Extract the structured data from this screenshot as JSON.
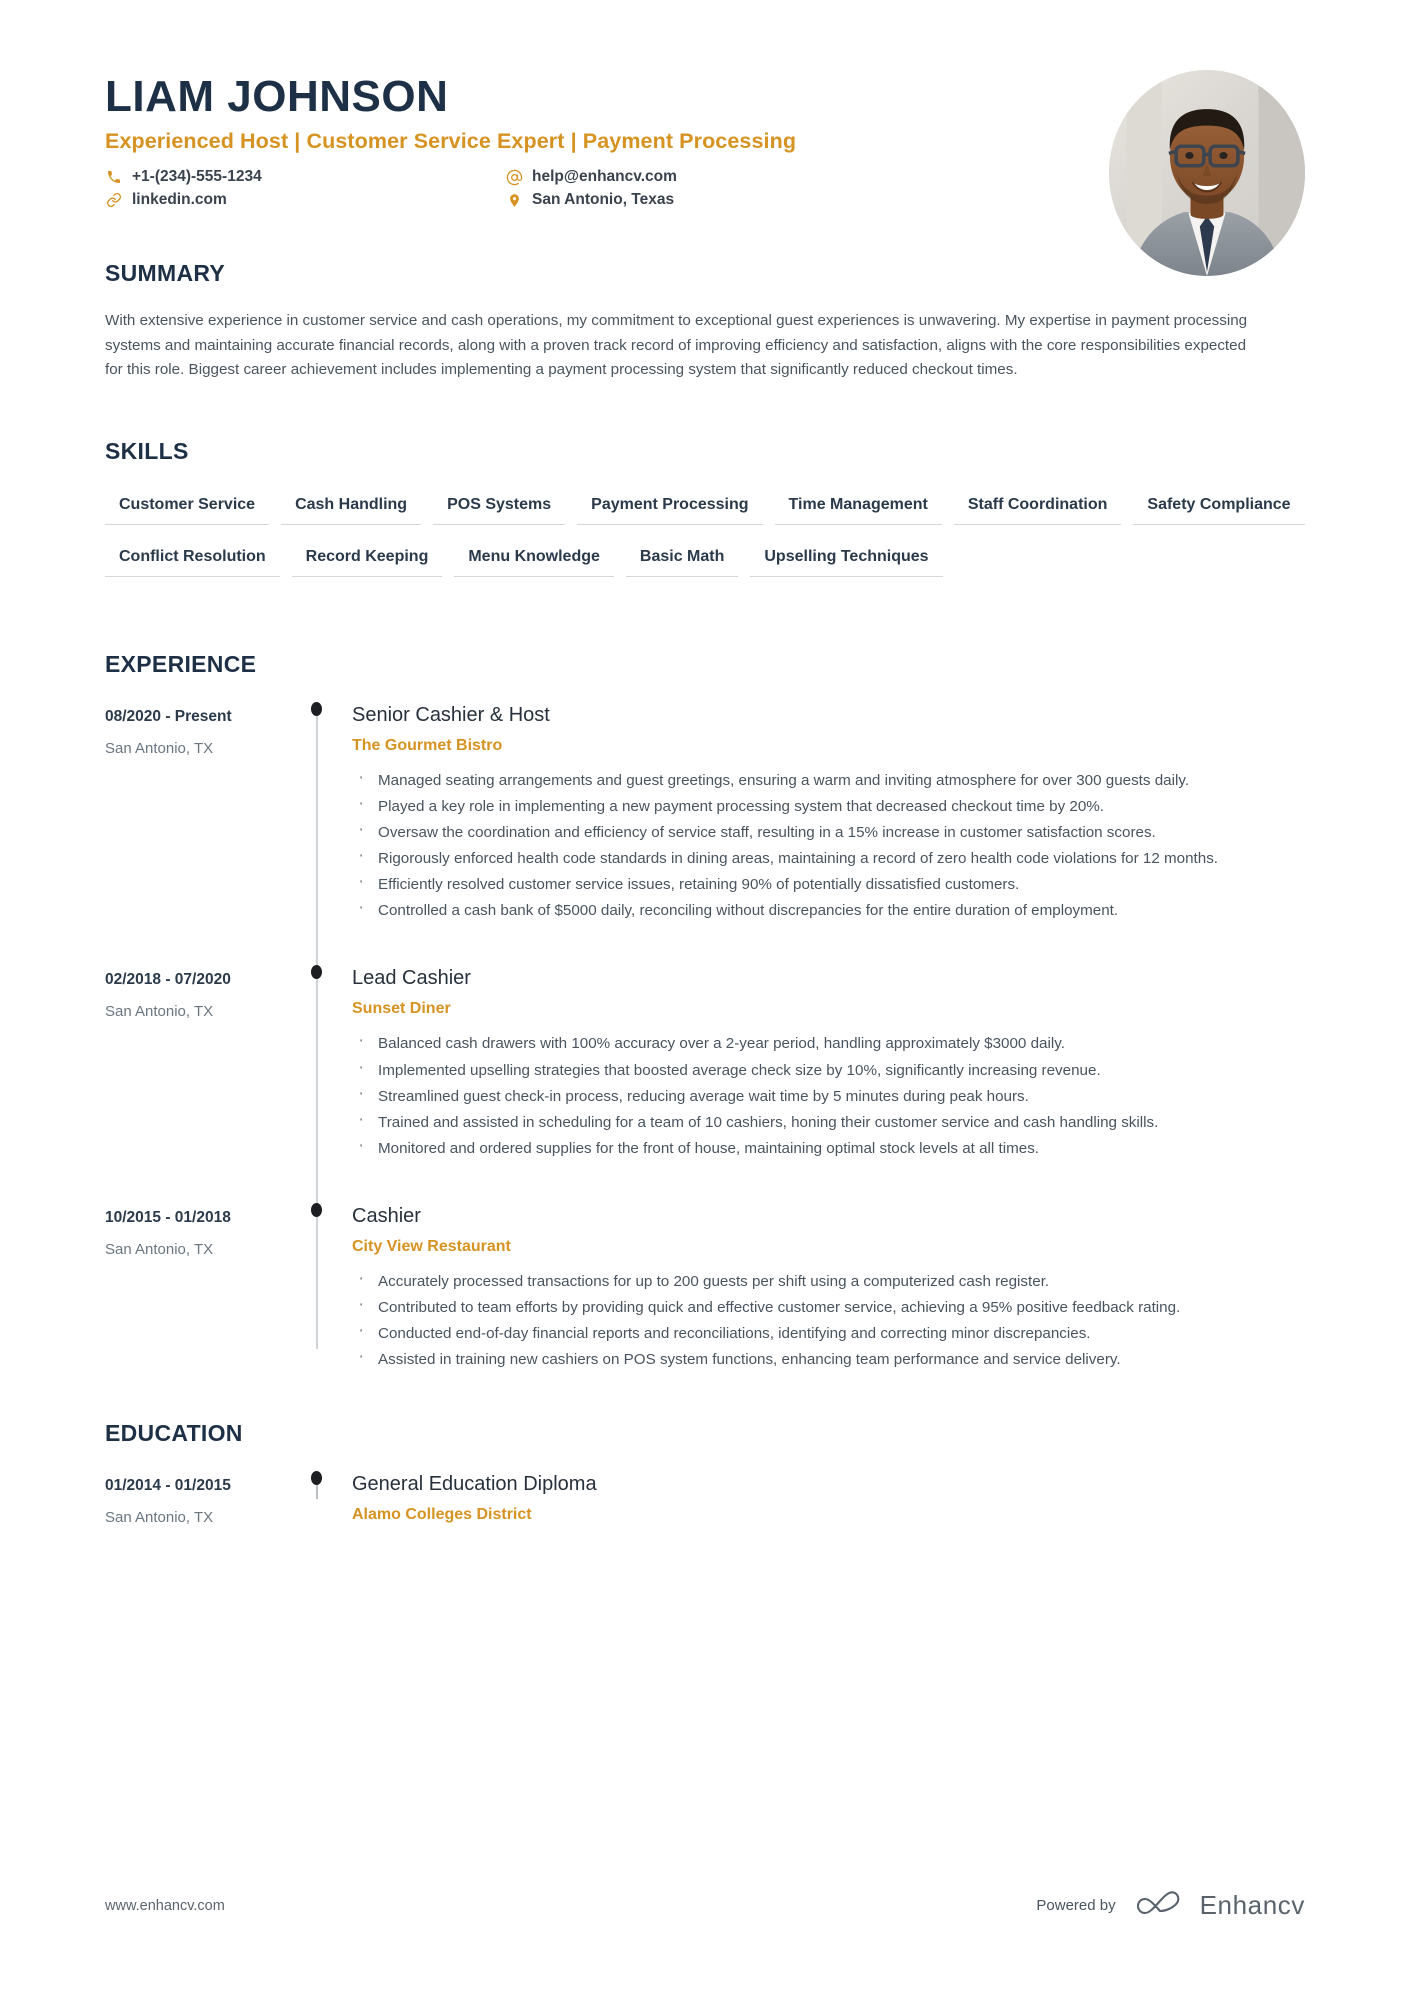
{
  "header": {
    "name": "LIAM JOHNSON",
    "headline": "Experienced Host | Customer Service Expert | Payment Processing",
    "contacts": {
      "phone": "+1-(234)-555-1234",
      "email": "help@enhancv.com",
      "linkedin": "linkedin.com",
      "location": "San Antonio, Texas"
    },
    "icons": {
      "phone": "phone-icon",
      "email": "at-sign-icon",
      "linkedin": "link-icon",
      "location": "map-pin-icon"
    },
    "photo_alt": "profile-photo"
  },
  "colors": {
    "accent": "#d69321",
    "heading": "#1d3045",
    "body": "#4a545e",
    "rule": "#d5d7d9"
  },
  "sections": {
    "summary": {
      "title": "SUMMARY",
      "text": "With extensive experience in customer service and cash operations, my commitment to exceptional guest experiences is unwavering. My expertise in payment processing systems and maintaining accurate financial records, along with a proven track record of improving efficiency and satisfaction, aligns with the core responsibilities expected for this role. Biggest career achievement includes implementing a payment processing system that significantly reduced checkout times."
    },
    "skills": {
      "title": "SKILLS",
      "items": [
        "Customer Service",
        "Cash Handling",
        "POS Systems",
        "Payment Processing",
        "Time Management",
        "Staff Coordination",
        "Safety Compliance",
        "Conflict Resolution",
        "Record Keeping",
        "Menu Knowledge",
        "Basic Math",
        "Upselling Techniques"
      ]
    },
    "experience": {
      "title": "EXPERIENCE",
      "entries": [
        {
          "date": "08/2020 - Present",
          "location": "San Antonio, TX",
          "title": "Senior Cashier & Host",
          "organization": "The Gourmet Bistro",
          "bullets": [
            "Managed seating arrangements and guest greetings, ensuring a warm and inviting atmosphere for over 300 guests daily.",
            "Played a key role in implementing a new payment processing system that decreased checkout time by 20%.",
            "Oversaw the coordination and efficiency of service staff, resulting in a 15% increase in customer satisfaction scores.",
            "Rigorously enforced health code standards in dining areas, maintaining a record of zero health code violations for 12 months.",
            "Efficiently resolved customer service issues, retaining 90% of potentially dissatisfied customers.",
            "Controlled a cash bank of $5000 daily, reconciling without discrepancies for the entire duration of employment."
          ]
        },
        {
          "date": "02/2018 - 07/2020",
          "location": "San Antonio, TX",
          "title": "Lead Cashier",
          "organization": "Sunset Diner",
          "bullets": [
            "Balanced cash drawers with 100% accuracy over a 2-year period, handling approximately $3000 daily.",
            "Implemented upselling strategies that boosted average check size by 10%, significantly increasing revenue.",
            "Streamlined guest check-in process, reducing average wait time by 5 minutes during peak hours.",
            "Trained and assisted in scheduling for a team of 10 cashiers, honing their customer service and cash handling skills.",
            "Monitored and ordered supplies for the front of house, maintaining optimal stock levels at all times."
          ]
        },
        {
          "date": "10/2015 - 01/2018",
          "location": "San Antonio, TX",
          "title": "Cashier",
          "organization": "City View Restaurant",
          "bullets": [
            "Accurately processed transactions for up to 200 guests per shift using a computerized cash register.",
            "Contributed to team efforts by providing quick and effective customer service, achieving a 95% positive feedback rating.",
            "Conducted end-of-day financial reports and reconciliations, identifying and correcting minor discrepancies.",
            "Assisted in training new cashiers on POS system functions, enhancing team performance and service delivery."
          ]
        }
      ]
    },
    "education": {
      "title": "EDUCATION",
      "entries": [
        {
          "date": "01/2014 - 01/2015",
          "location": "San Antonio, TX",
          "title": "General Education Diploma",
          "organization": "Alamo Colleges District"
        }
      ]
    }
  },
  "footer": {
    "url": "www.enhancv.com",
    "powered_by": "Powered by",
    "brand": "Enhancv"
  }
}
